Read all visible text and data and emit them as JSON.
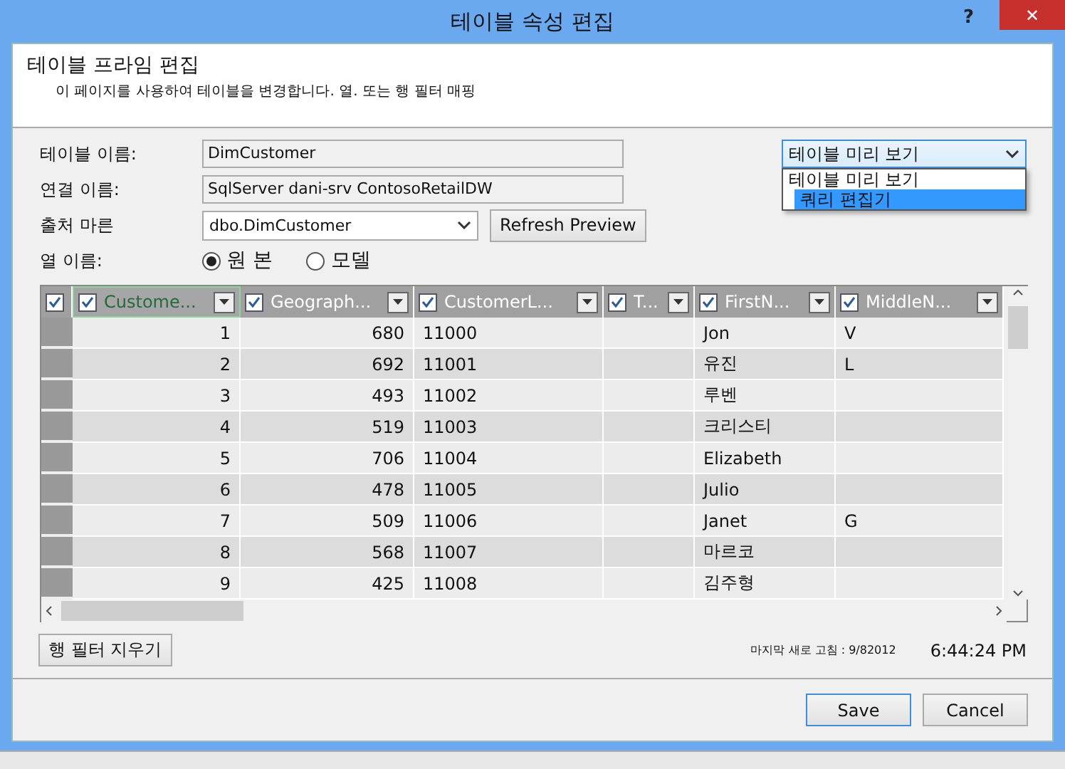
{
  "window": {
    "title": "테이블 속성 편집",
    "help": "?",
    "close": "✕"
  },
  "header": {
    "title": "테이블 프라임 편집",
    "subtitle": "이 페이지를 사용하여 테이블을 변경합니다. 열. 또는 행 필터 매핑"
  },
  "form": {
    "table_name": {
      "label": "테이블 이름:",
      "value": "DimCustomer"
    },
    "connection_name": {
      "label": "연결 이름:",
      "value": "SqlServer dani-srv ContosoRetailDW"
    },
    "source": {
      "label": "출처 마른",
      "value": "dbo.DimCustomer",
      "button": "Refresh Preview"
    },
    "column_names": {
      "label": "열 이름:",
      "options": [
        {
          "label": "원 본",
          "selected": true
        },
        {
          "label": "모델",
          "selected": false
        }
      ]
    }
  },
  "view_select": {
    "value": "테이블 미리 보기",
    "expanded": true,
    "options": [
      {
        "label": "테이블 미리 보기",
        "highlighted": false
      },
      {
        "label": "쿼리 편집기",
        "highlighted": true
      }
    ]
  },
  "table": {
    "select_all_checked": true,
    "columns": [
      {
        "label": "Custome...",
        "checked": true,
        "kind": "number"
      },
      {
        "label": "Geograph...",
        "checked": true,
        "kind": "number"
      },
      {
        "label": "CustomerL...",
        "checked": true,
        "kind": "text"
      },
      {
        "label": "T...",
        "checked": true,
        "kind": "text"
      },
      {
        "label": "FirstN...",
        "checked": true,
        "kind": "text"
      },
      {
        "label": "MiddleN...",
        "checked": true,
        "kind": "text"
      }
    ],
    "rows": [
      [
        "1",
        "680",
        "11000",
        "",
        "Jon",
        "V"
      ],
      [
        "2",
        "692",
        "11001",
        "",
        "유진",
        "L"
      ],
      [
        "3",
        "493",
        "11002",
        "",
        "루벤",
        ""
      ],
      [
        "4",
        "519",
        "11003",
        "",
        "크리스티",
        ""
      ],
      [
        "5",
        "706",
        "11004",
        "",
        "Elizabeth",
        ""
      ],
      [
        "6",
        "478",
        "11005",
        "",
        "Julio",
        ""
      ],
      [
        "7",
        "509",
        "11006",
        "",
        "Janet",
        "G"
      ],
      [
        "8",
        "568",
        "11007",
        "",
        "마르코",
        ""
      ],
      [
        "9",
        "425",
        "11008",
        "",
        "김주형",
        ""
      ]
    ]
  },
  "clear_filter_button": "행 필터 지우기",
  "last_refresh": {
    "label": "마지막 새로 고침 : 9/82012",
    "time": "6:44:24 PM"
  },
  "buttons": [
    {
      "label": "Save",
      "default": true
    },
    {
      "label": "Cancel",
      "default": false
    }
  ]
}
